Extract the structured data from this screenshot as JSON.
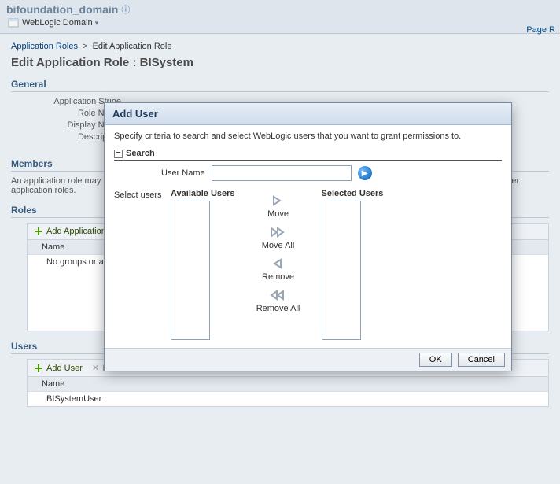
{
  "header": {
    "domain_title": "bifoundation_domain",
    "domain_menu_label": "WebLogic Domain",
    "page_link": "Page R"
  },
  "breadcrumb": {
    "root": "Application Roles",
    "current": "Edit Application Role"
  },
  "page_title": "Edit Application Role : BISystem",
  "general": {
    "section": "General",
    "fields": {
      "app_stripe": "Application Stripe",
      "role_name": "Role Name",
      "display_name": "Display Name",
      "description": "Description"
    }
  },
  "members": {
    "section": "Members",
    "note": "An application role may need to be mapped to users or groups defined in enterprise LDAP server, or the role can be mapped to other application roles.",
    "roles": {
      "heading": "Roles",
      "add_label": "Add Application Role",
      "col_name": "Name",
      "empty": "No groups or application roles added."
    },
    "users": {
      "heading": "Users",
      "add_label": "Add User",
      "delete_label": "Delete...",
      "col_name": "Name",
      "rows": [
        "BISystemUser"
      ]
    }
  },
  "modal": {
    "title": "Add User",
    "instructions": "Specify criteria to search and select WebLogic users that you want to grant permissions to.",
    "search_label": "Search",
    "user_name_label": "User Name",
    "user_name_value": "",
    "select_users": "Select users",
    "available_hdr": "Available Users",
    "selected_hdr": "Selected Users",
    "move": "Move",
    "move_all": "Move All",
    "remove": "Remove",
    "remove_all": "Remove All",
    "ok": "OK",
    "cancel": "Cancel"
  }
}
